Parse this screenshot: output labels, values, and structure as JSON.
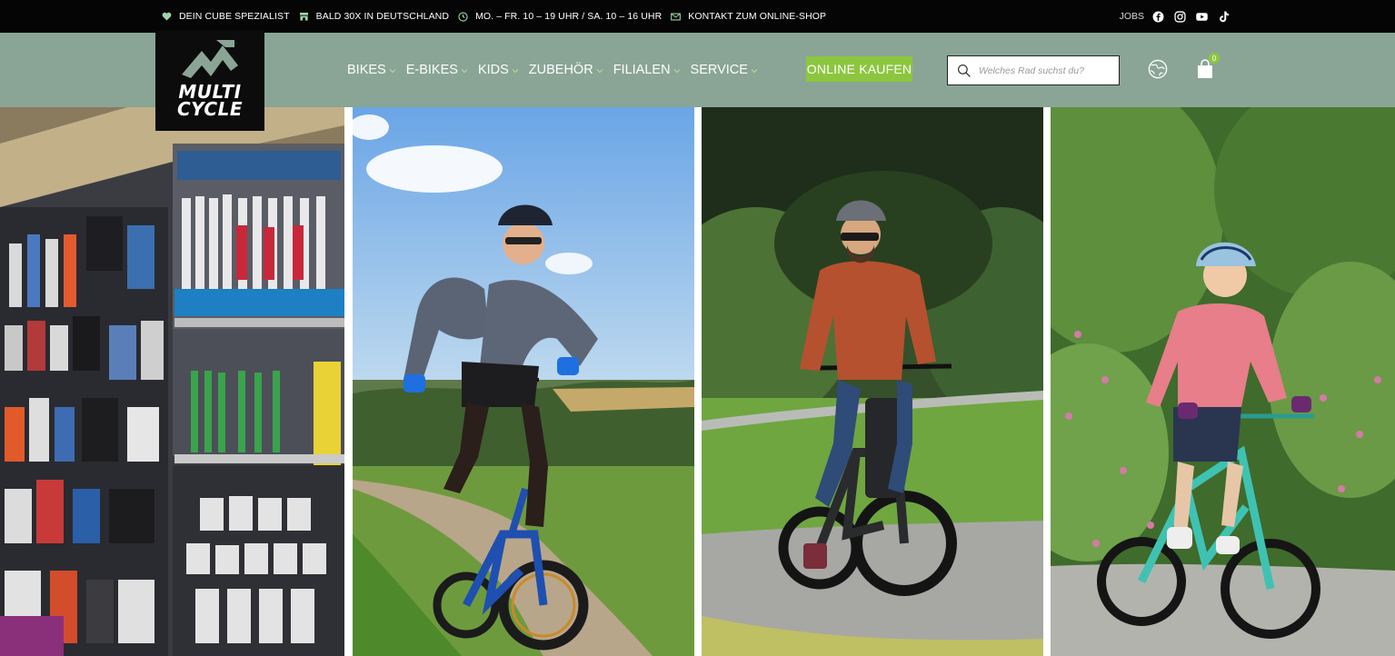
{
  "topbar": {
    "items": [
      {
        "icon": "heart-icon",
        "label": "DEIN CUBE SPEZIALIST"
      },
      {
        "icon": "store-icon",
        "label": "BALD 30X IN DEUTSCHLAND"
      },
      {
        "icon": "clock-icon",
        "label": "MO. – FR. 10 – 19 UHR / SA. 10 – 16 UHR"
      },
      {
        "icon": "mail-icon",
        "label": "KONTAKT ZUM ONLINE-SHOP"
      }
    ],
    "jobs_label": "JOBS",
    "social": [
      "facebook-icon",
      "instagram-icon",
      "youtube-icon",
      "tiktok-icon"
    ]
  },
  "brand": {
    "line1": "MULTI",
    "line2": "CYCLE"
  },
  "nav": {
    "items": [
      {
        "label": "BIKES"
      },
      {
        "label": "E-BIKES"
      },
      {
        "label": "KIDS"
      },
      {
        "label": "ZUBEHÖR"
      },
      {
        "label": "FILIALEN"
      },
      {
        "label": "SERVICE"
      }
    ]
  },
  "header": {
    "shop_button": "ONLINE KAUFEN",
    "search_placeholder": "Welches Rad suchst du?",
    "cart_count": "0"
  },
  "hero": {
    "panels": [
      {
        "name": "accessories-shop-photo"
      },
      {
        "name": "mountain-bike-rider-photo"
      },
      {
        "name": "e-bike-rider-photo"
      },
      {
        "name": "kids-bike-rider-photo"
      }
    ]
  },
  "colors": {
    "topbar": "#050505",
    "header": "#8aa595",
    "accent_green": "#8cc63f",
    "logo_bg": "#0c0c0c"
  }
}
